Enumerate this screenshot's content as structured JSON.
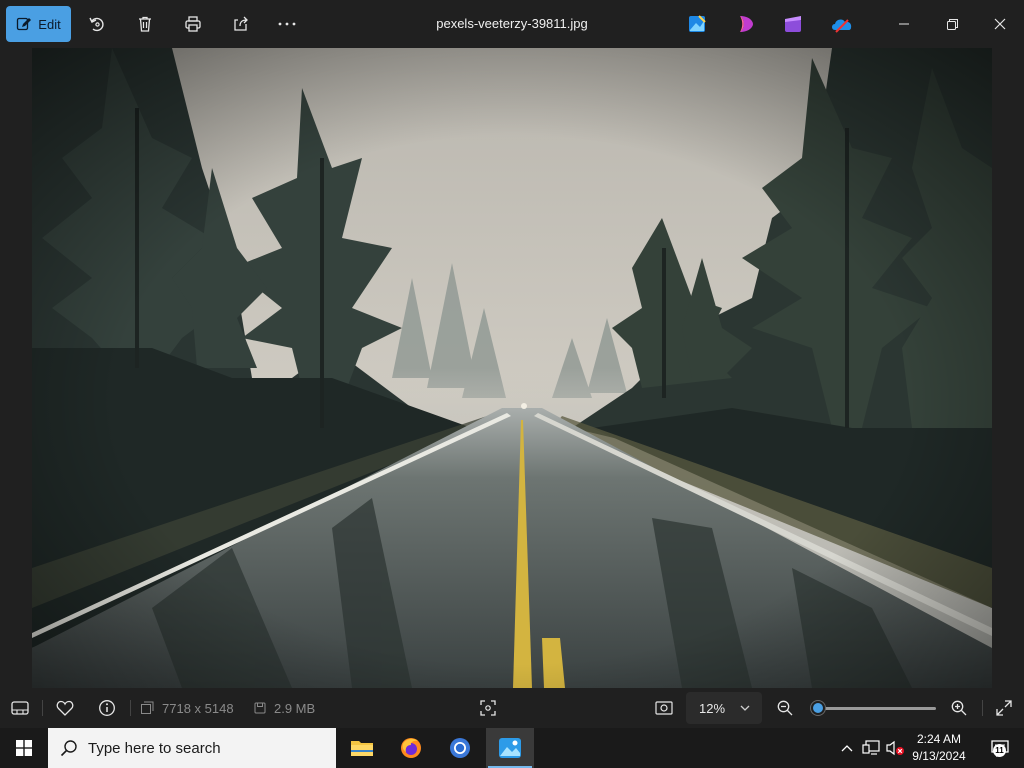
{
  "toolbar": {
    "edit_label": "Edit",
    "filename": "pexels-veeterzy-39811.jpg",
    "accent_color": "#4a9fe3"
  },
  "image": {
    "subject_icon": "photo"
  },
  "statusbar": {
    "dimensions": "7718 x 5148",
    "file_size": "2.9 MB",
    "zoom_value": "12%",
    "zoom_slider_level": 0.0
  },
  "taskbar": {
    "search_placeholder": "Type here to search",
    "time": "2:24 AM",
    "date": "9/13/2024",
    "notification_count": "11"
  }
}
